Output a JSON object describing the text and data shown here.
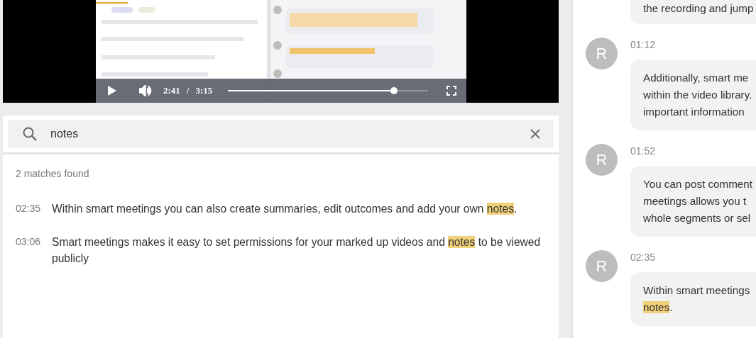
{
  "player": {
    "current_time": "2:41",
    "separator": "/",
    "duration": "3:15",
    "level": 0.83
  },
  "search": {
    "value": "notes"
  },
  "results": {
    "summary": "2 matches found",
    "items": [
      {
        "time": "02:35",
        "segments": [
          {
            "text": "Within smart meetings you can also create summaries, edit outcomes and add your own ",
            "highlighted": false
          },
          {
            "text": "notes",
            "highlighted": true
          },
          {
            "text": ".",
            "highlighted": false
          }
        ]
      },
      {
        "time": "03:06",
        "segments": [
          {
            "text": "Smart meetings makes it easy to set permissions for your marked up videos and ",
            "highlighted": false
          },
          {
            "text": "notes",
            "highlighted": true
          },
          {
            "text": " to be viewed publicly",
            "highlighted": false
          }
        ]
      }
    ]
  },
  "transcript": {
    "top_fragment": "the recording and jump",
    "messages": [
      {
        "avatar": "R",
        "time": "01:12",
        "lines": [
          [
            {
              "text": "Additionally, smart me",
              "highlighted": false
            }
          ],
          [
            {
              "text": "within the video library.",
              "highlighted": false
            }
          ],
          [
            {
              "text": "important information",
              "highlighted": false
            }
          ]
        ]
      },
      {
        "avatar": "R",
        "time": "01:52",
        "lines": [
          [
            {
              "text": "You can post comment",
              "highlighted": false
            }
          ],
          [
            {
              "text": "meetings allows you t",
              "highlighted": false
            }
          ],
          [
            {
              "text": "whole segments or sel",
              "highlighted": false
            }
          ]
        ]
      },
      {
        "avatar": "R",
        "time": "02:35",
        "lines": [
          [
            {
              "text": "Within smart meetings",
              "highlighted": false
            }
          ],
          [
            {
              "text": "notes",
              "highlighted": true
            },
            {
              "text": ".",
              "highlighted": false
            }
          ]
        ]
      }
    ]
  }
}
